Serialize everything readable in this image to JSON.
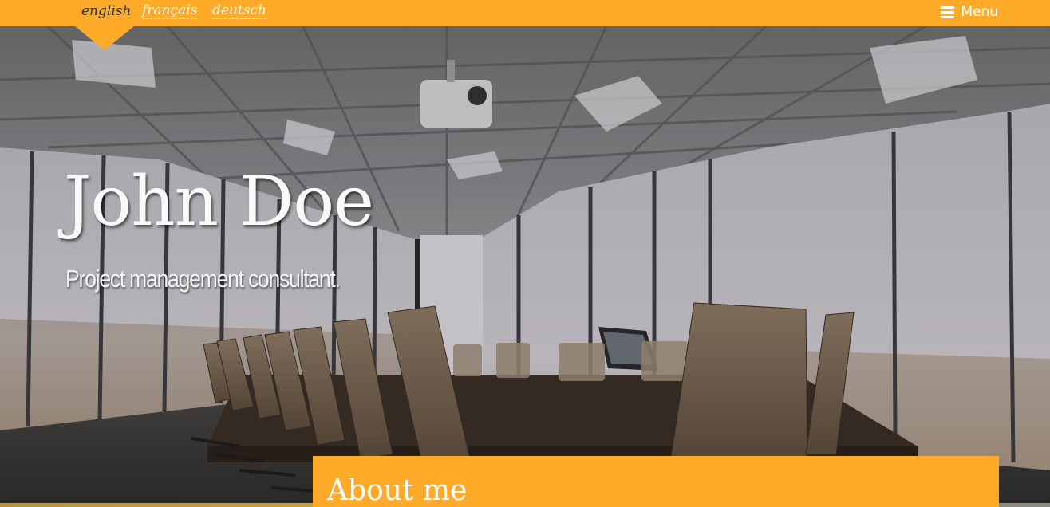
{
  "header": {
    "languages": [
      {
        "label": "english",
        "active": true
      },
      {
        "label": "français",
        "active": false
      },
      {
        "label": "deutsch",
        "active": false
      }
    ],
    "menu_label": "Menu",
    "menu_icon": "hamburger-icon"
  },
  "hero": {
    "title": "John Doe",
    "subtitle": "Project management consultant.",
    "background": "conference-room-photo"
  },
  "about": {
    "heading": "About me"
  },
  "colors": {
    "accent": "#ffaa28",
    "text_light": "#ffffff",
    "text_dark": "#333333"
  }
}
